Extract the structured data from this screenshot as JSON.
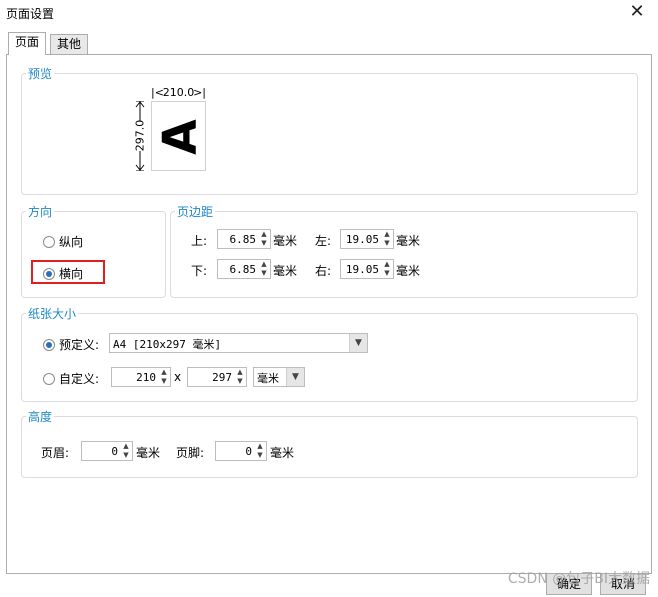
{
  "window": {
    "title": "页面设置",
    "close_glyph": "✕"
  },
  "tabs": [
    {
      "label": "页面",
      "active": true
    },
    {
      "label": "其他",
      "active": false
    }
  ],
  "preview": {
    "legend": "预览",
    "width_value": "210.0",
    "height_value": "297.0",
    "letter": "A"
  },
  "orientation": {
    "legend": "方向",
    "portrait_label": "纵向",
    "landscape_label": "横向",
    "selected": "landscape"
  },
  "margins": {
    "legend": "页边距",
    "top_label": "上:",
    "top_value": "6.85",
    "top_unit": "毫米",
    "left_label": "左:",
    "left_value": "19.05",
    "left_unit": "毫米",
    "bottom_label": "下:",
    "bottom_value": "6.85",
    "bottom_unit": "毫米",
    "right_label": "右:",
    "right_value": "19.05",
    "right_unit": "毫米"
  },
  "paper_size": {
    "legend": "纸张大小",
    "predefined_label": "预定义:",
    "predefined_value": "A4 [210x297 毫米]",
    "custom_label": "自定义:",
    "custom_width": "210",
    "times": "x",
    "custom_height": "297",
    "custom_unit": "毫米",
    "selected": "predefined"
  },
  "height_section": {
    "legend": "高度",
    "header_label": "页眉:",
    "header_value": "0",
    "header_unit": "毫米",
    "footer_label": "页脚:",
    "footer_value": "0",
    "footer_unit": "毫米"
  },
  "buttons": {
    "ok": "确定",
    "cancel": "取消"
  },
  "watermark": "CSDN @包子BI大数据",
  "colors": {
    "accent": "#1e88c7",
    "highlight": "#e02020",
    "radio_dot": "#2a6ebd"
  }
}
